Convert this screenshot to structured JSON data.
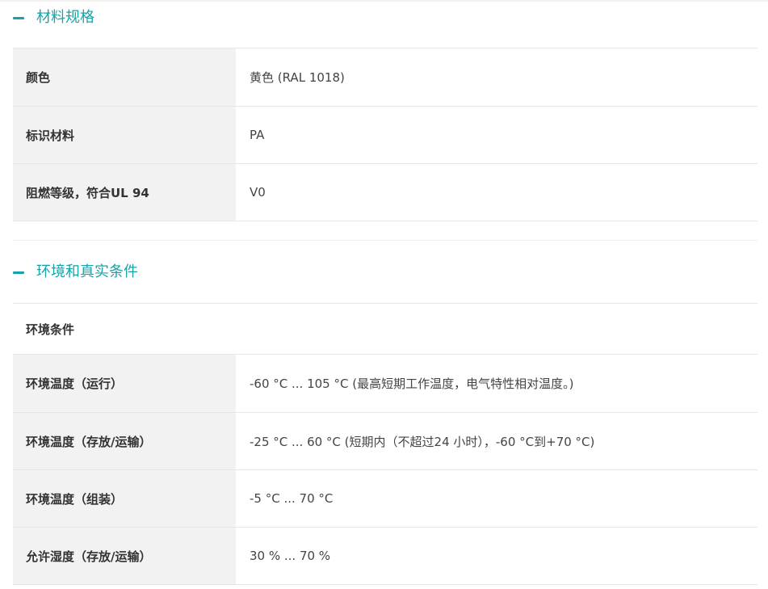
{
  "section1": {
    "title": "材料规格",
    "rows": [
      {
        "label": "颜色",
        "value": "黄色 (RAL 1018)"
      },
      {
        "label": "标识材料",
        "value": "PA"
      },
      {
        "label": "阻燃等级，符合UL 94",
        "value": "V0"
      }
    ]
  },
  "section2": {
    "title": "环境和真实条件",
    "subheading": "环境条件",
    "rows": [
      {
        "label": "环境温度（运行）",
        "value": "-60 °C ... 105 °C (最高短期工作温度，电气特性相对温度。)"
      },
      {
        "label": "环境温度（存放/运输）",
        "value": "-25 °C ... 60 °C (短期内（不超过24  小时），-60 °C到+70 °C)"
      },
      {
        "label": "环境温度（组装）",
        "value": "-5 °C ... 70 °C"
      },
      {
        "label": "允许湿度（存放/运输）",
        "value": "30 % ... 70 %"
      }
    ]
  }
}
